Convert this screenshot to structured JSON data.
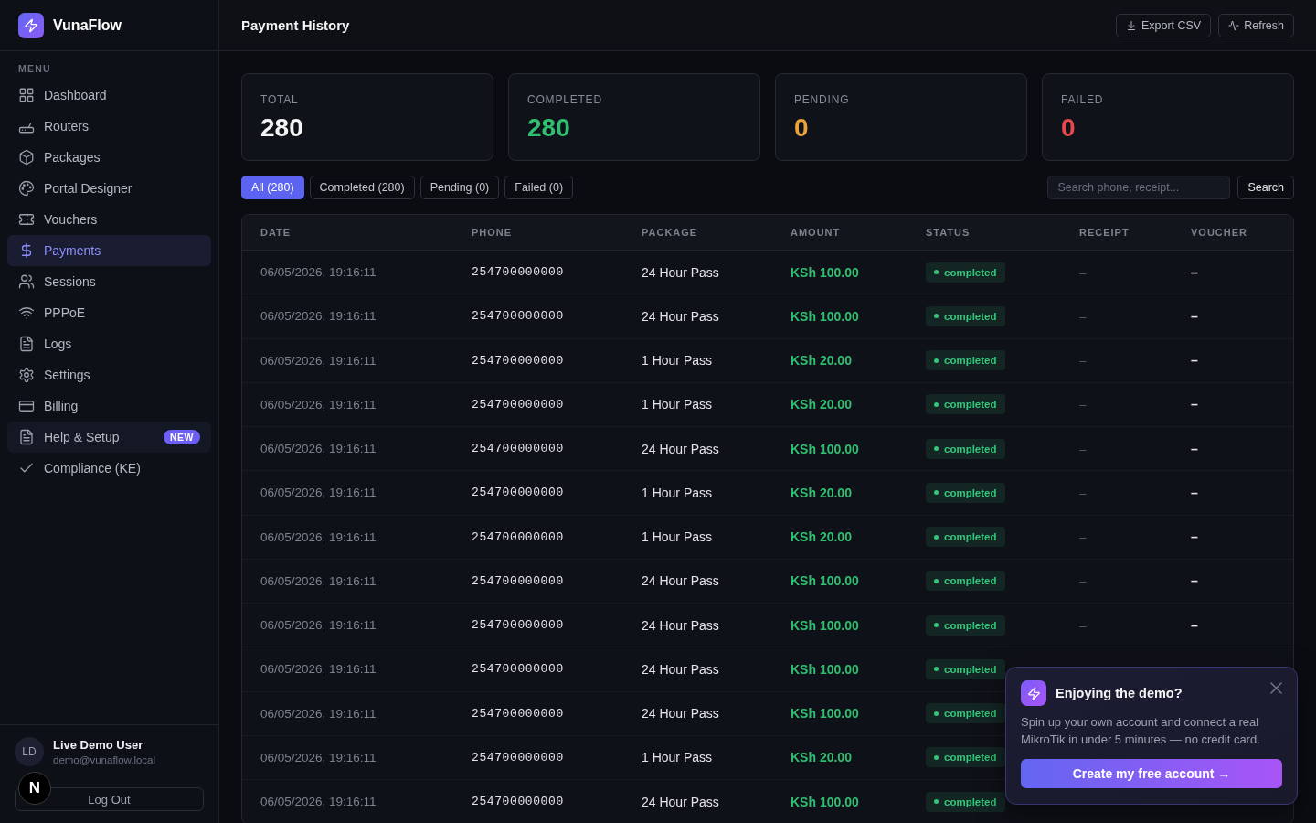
{
  "app": {
    "name": "VunaFlow"
  },
  "sidebar": {
    "section_label": "MENU",
    "items": [
      {
        "label": "Dashboard",
        "selected": false,
        "highlighted": false
      },
      {
        "label": "Routers",
        "selected": false,
        "highlighted": false
      },
      {
        "label": "Packages",
        "selected": false,
        "highlighted": false
      },
      {
        "label": "Portal Designer",
        "selected": false,
        "highlighted": false
      },
      {
        "label": "Vouchers",
        "selected": false,
        "highlighted": false
      },
      {
        "label": "Payments",
        "selected": true,
        "highlighted": false
      },
      {
        "label": "Sessions",
        "selected": false,
        "highlighted": false
      },
      {
        "label": "PPPoE",
        "selected": false,
        "highlighted": false
      },
      {
        "label": "Logs",
        "selected": false,
        "highlighted": false
      },
      {
        "label": "Settings",
        "selected": false,
        "highlighted": false
      },
      {
        "label": "Billing",
        "selected": false,
        "highlighted": false
      },
      {
        "label": "Help & Setup",
        "selected": false,
        "highlighted": true,
        "badge": "NEW"
      },
      {
        "label": "Compliance (KE)",
        "selected": false,
        "highlighted": false
      }
    ]
  },
  "user": {
    "initials": "LD",
    "name": "Live Demo User",
    "email": "demo@vunaflow.local",
    "logout": "Log Out"
  },
  "dev_indicator": {
    "label": "N"
  },
  "header": {
    "title": "Payment History",
    "actions": [
      "Export CSV",
      "Refresh"
    ]
  },
  "stats": [
    {
      "label": "TOTAL",
      "value": "280",
      "color": "#f4f4f5"
    },
    {
      "label": "COMPLETED",
      "value": "280",
      "color": "#2fbf71"
    },
    {
      "label": "PENDING",
      "value": "0",
      "color": "#eaa23a"
    },
    {
      "label": "FAILED",
      "value": "0",
      "color": "#e5484d"
    }
  ],
  "filters": [
    {
      "label": "All (280)",
      "selected": true
    },
    {
      "label": "Completed (280)",
      "selected": false
    },
    {
      "label": "Pending (0)",
      "selected": false
    },
    {
      "label": "Failed (0)",
      "selected": false
    }
  ],
  "search": {
    "placeholder": "Search phone, receipt...",
    "button": "Search"
  },
  "table": {
    "columns": [
      "DATE",
      "PHONE",
      "PACKAGE",
      "AMOUNT",
      "STATUS",
      "RECEIPT",
      "VOUCHER"
    ],
    "rows": [
      {
        "date": "06/05/2026, 19:16:11",
        "phone": "254700000000",
        "package": "24 Hour Pass",
        "amount": "KSh 100.00",
        "status": {
          "label": "completed",
          "color": "#34c77b"
        },
        "receipt": "–",
        "voucher": "–"
      },
      {
        "date": "06/05/2026, 19:16:11",
        "phone": "254700000000",
        "package": "24 Hour Pass",
        "amount": "KSh 100.00",
        "status": {
          "label": "completed",
          "color": "#34c77b"
        },
        "receipt": "–",
        "voucher": "–"
      },
      {
        "date": "06/05/2026, 19:16:11",
        "phone": "254700000000",
        "package": "1 Hour Pass",
        "amount": "KSh 20.00",
        "status": {
          "label": "completed",
          "color": "#34c77b"
        },
        "receipt": "–",
        "voucher": "–"
      },
      {
        "date": "06/05/2026, 19:16:11",
        "phone": "254700000000",
        "package": "1 Hour Pass",
        "amount": "KSh 20.00",
        "status": {
          "label": "completed",
          "color": "#34c77b"
        },
        "receipt": "–",
        "voucher": "–"
      },
      {
        "date": "06/05/2026, 19:16:11",
        "phone": "254700000000",
        "package": "24 Hour Pass",
        "amount": "KSh 100.00",
        "status": {
          "label": "completed",
          "color": "#34c77b"
        },
        "receipt": "–",
        "voucher": "–"
      },
      {
        "date": "06/05/2026, 19:16:11",
        "phone": "254700000000",
        "package": "1 Hour Pass",
        "amount": "KSh 20.00",
        "status": {
          "label": "completed",
          "color": "#34c77b"
        },
        "receipt": "–",
        "voucher": "–"
      },
      {
        "date": "06/05/2026, 19:16:11",
        "phone": "254700000000",
        "package": "1 Hour Pass",
        "amount": "KSh 20.00",
        "status": {
          "label": "completed",
          "color": "#34c77b"
        },
        "receipt": "–",
        "voucher": "–"
      },
      {
        "date": "06/05/2026, 19:16:11",
        "phone": "254700000000",
        "package": "24 Hour Pass",
        "amount": "KSh 100.00",
        "status": {
          "label": "completed",
          "color": "#34c77b"
        },
        "receipt": "–",
        "voucher": "–"
      },
      {
        "date": "06/05/2026, 19:16:11",
        "phone": "254700000000",
        "package": "24 Hour Pass",
        "amount": "KSh 100.00",
        "status": {
          "label": "completed",
          "color": "#34c77b"
        },
        "receipt": "–",
        "voucher": "–"
      },
      {
        "date": "06/05/2026, 19:16:11",
        "phone": "254700000000",
        "package": "24 Hour Pass",
        "amount": "KSh 100.00",
        "status": {
          "label": "completed",
          "color": "#34c77b"
        }
      },
      {
        "date": "06/05/2026, 19:16:11",
        "phone": "254700000000",
        "package": "24 Hour Pass",
        "amount": "KSh 100.00",
        "status": {
          "label": "completed",
          "color": "#34c77b"
        }
      },
      {
        "date": "06/05/2026, 19:16:11",
        "phone": "254700000000",
        "package": "1 Hour Pass",
        "amount": "KSh 20.00",
        "status": {
          "label": "completed",
          "color": "#34c77b"
        }
      },
      {
        "date": "06/05/2026, 19:16:11",
        "phone": "254700000000",
        "package": "24 Hour Pass",
        "amount": "KSh 100.00",
        "status": {
          "label": "completed",
          "color": "#34c77b"
        }
      }
    ]
  },
  "promo": {
    "title": "Enjoying the demo?",
    "text": "Spin up your own account and connect a real MikroTik in under 5 minutes — no credit card.",
    "button": "Create my free account →"
  }
}
